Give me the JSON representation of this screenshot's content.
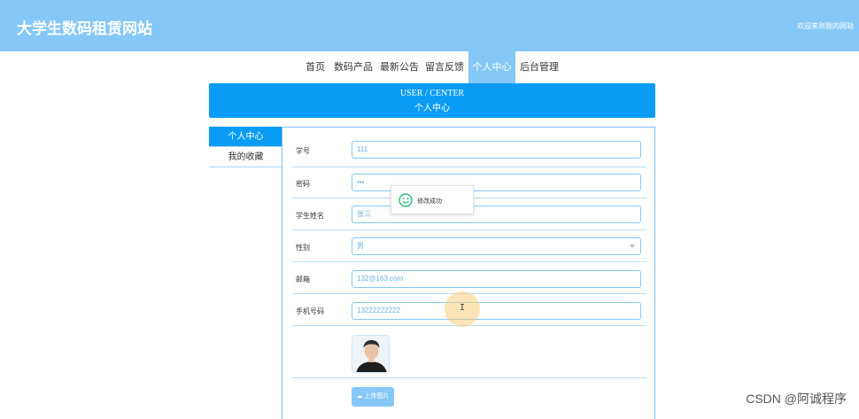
{
  "header": {
    "site_title": "大学生数码租赁网站",
    "welcome_text": "欢迎来到我的网站"
  },
  "nav": {
    "items": [
      {
        "label": "首页"
      },
      {
        "label": "数码产品"
      },
      {
        "label": "最新公告"
      },
      {
        "label": "留言反馈"
      },
      {
        "label": "个人中心",
        "active": true
      },
      {
        "label": "后台管理"
      }
    ]
  },
  "banner": {
    "title_en": "USER / CENTER",
    "title_cn": "个人中心"
  },
  "sidebar": {
    "items": [
      {
        "label": "个人中心",
        "active": true
      },
      {
        "label": "我的收藏"
      }
    ]
  },
  "form": {
    "student_id": {
      "label": "学号",
      "value": "111"
    },
    "password": {
      "label": "密码",
      "value": "•••"
    },
    "student_name": {
      "label": "学生姓名",
      "value": "张三"
    },
    "gender": {
      "label": "性别",
      "value": "男"
    },
    "email": {
      "label": "邮箱",
      "value": "132@163.com"
    },
    "phone": {
      "label": "手机号码",
      "value": "13222222222"
    },
    "upload_label": "上传图片"
  },
  "toast": {
    "message": "修改成功",
    "icon": "smile-icon"
  },
  "cursor": {
    "glyph": "I"
  },
  "watermark": "CSDN @阿诚程序",
  "colors": {
    "header_bg": "#85c8f8",
    "accent": "#0a9cf5",
    "toast_icon": "#2fbf71"
  }
}
